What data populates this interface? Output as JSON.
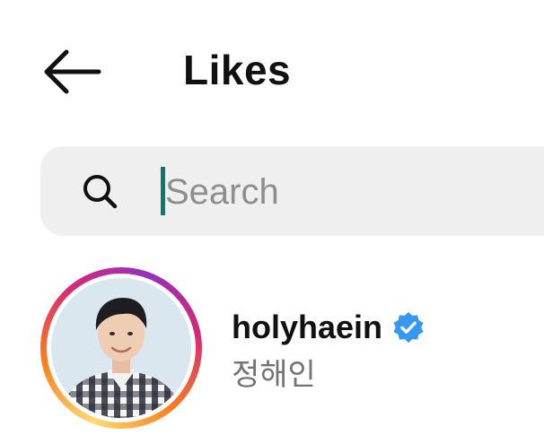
{
  "header": {
    "back_icon": "arrow-left-icon",
    "title": "Likes"
  },
  "search": {
    "icon": "search-icon",
    "placeholder": "Search",
    "value": ""
  },
  "users": [
    {
      "username": "holyhaein",
      "full_name": "정해인",
      "verified": true,
      "verified_icon": "verified-badge-icon",
      "has_story_ring": true
    }
  ],
  "colors": {
    "search_background": "#efefef",
    "caret": "#0c7a6a",
    "verified_blue": "#3897f0",
    "secondary_text": "#737373",
    "story_ring": [
      "#feda75",
      "#fa7e1e",
      "#d62976",
      "#962fbf"
    ]
  }
}
